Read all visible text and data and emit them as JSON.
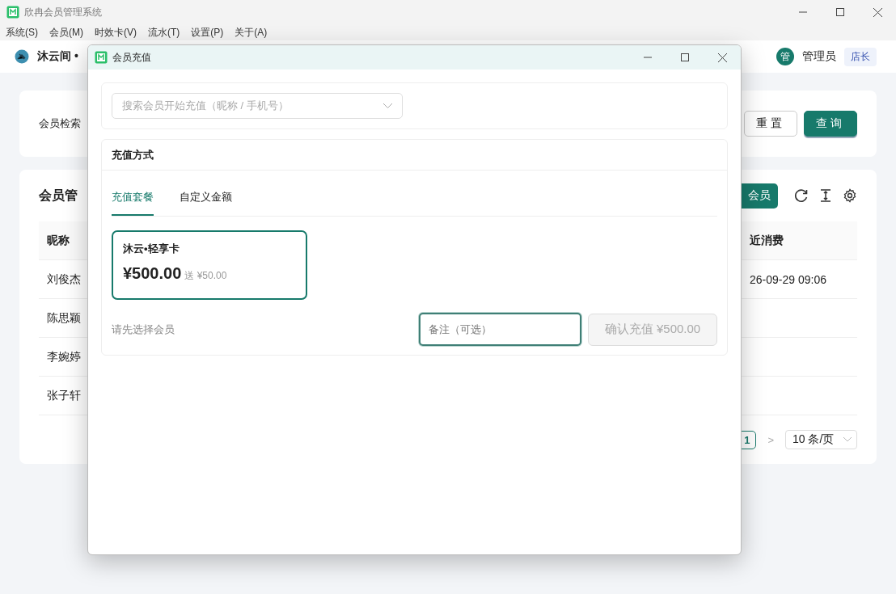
{
  "window": {
    "title": "欣冉会员管理系统"
  },
  "menu": [
    "系统(S)",
    "会员(M)",
    "时效卡(V)",
    "流水(T)",
    "设置(P)",
    "关于(A)"
  ],
  "header": {
    "shop": "沐云间 •",
    "user_avatar": "管",
    "user": "管理员",
    "role": "店长"
  },
  "search_card": {
    "label": "会员检索",
    "buttons": [
      {
        "label": "重置",
        "kind": "plain"
      },
      {
        "label": "查询",
        "kind": "primary"
      }
    ]
  },
  "member_card": {
    "title": "会员管",
    "add_button": "会员",
    "columns": [
      "昵称",
      "近消费"
    ],
    "rows": [
      {
        "name": "刘俊杰",
        "last": "26-09-29 09:06"
      },
      {
        "name": "陈思颖"
      },
      {
        "name": "李婉婷"
      },
      {
        "name": "张子轩"
      }
    ],
    "pagination": {
      "pages": [
        {
          "label": "1",
          "selected": true
        }
      ],
      "next": ">",
      "page_size": "10 条/页"
    }
  },
  "dialog": {
    "title": "会员充值",
    "search": {
      "placeholder": "搜索会员开始充值（昵称 / 手机号）"
    },
    "section_title": "充值方式",
    "tabs": [
      {
        "label": "充值套餐",
        "selected": true
      },
      {
        "label": "自定义金额",
        "selected": false
      }
    ],
    "packages": [
      {
        "name": "沐云•轻享卡",
        "price": "¥500.00",
        "bonus": "送 ¥50.00",
        "selected": true
      }
    ],
    "hint": "请先选择会员",
    "note": {
      "placeholder": "备注（可选）"
    },
    "confirm": {
      "label": "确认充值 ¥500.00",
      "disabled": true
    }
  }
}
